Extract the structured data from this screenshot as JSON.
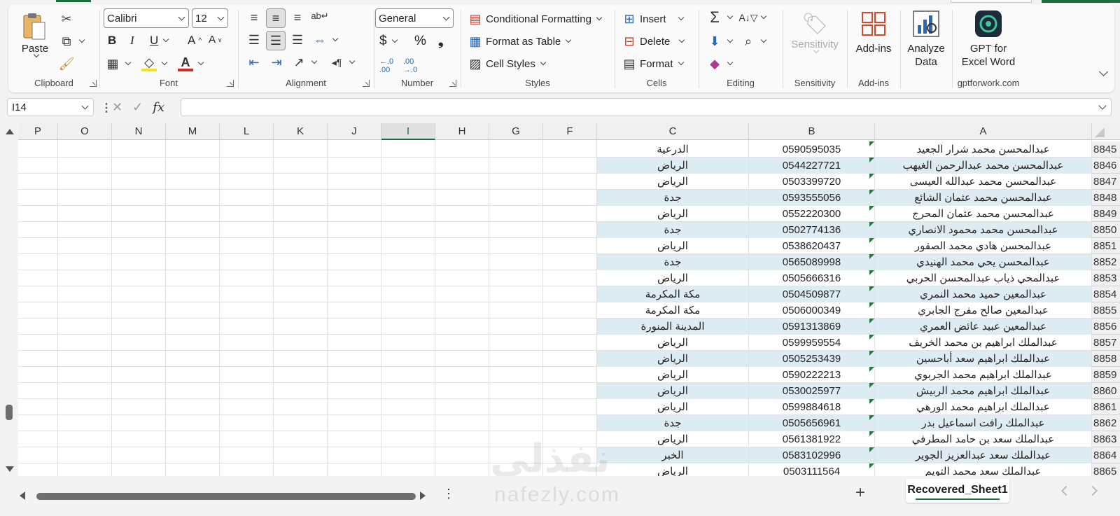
{
  "ribbon": {
    "clipboard": {
      "paste": "Paste",
      "label": "Clipboard"
    },
    "font": {
      "name": "Calibri",
      "size": "12",
      "label": "Font"
    },
    "alignment": {
      "label": "Alignment"
    },
    "number": {
      "format": "General",
      "currency": "$",
      "percent": "%",
      "comma": "❟",
      "label": "Number"
    },
    "styles": {
      "conditional": "Conditional Formatting",
      "table": "Format as Table",
      "cell_styles": "Cell Styles",
      "label": "Styles"
    },
    "cells": {
      "insert": "Insert",
      "delete": "Delete",
      "format": "Format",
      "label": "Cells"
    },
    "editing": {
      "label": "Editing"
    },
    "sensitivity": {
      "button": "Sensitivity",
      "label": "Sensitivity"
    },
    "addins": {
      "button": "Add-ins",
      "label": "Add-ins"
    },
    "analyze": {
      "line1": "Analyze",
      "line2": "Data"
    },
    "gpt": {
      "line1": "GPT for",
      "line2": "Excel Word",
      "label": "gptforwork.com"
    }
  },
  "formula_bar": {
    "name_box": "I14",
    "fx": "fx",
    "value": ""
  },
  "columns": [
    "P",
    "O",
    "N",
    "M",
    "L",
    "K",
    "J",
    "I",
    "H",
    "G",
    "F",
    "C",
    "B",
    "A"
  ],
  "selected_column": "I",
  "rows": [
    {
      "num": "8845",
      "name": "عبدالمحسن محمد شرار الجعيد",
      "phone": "0590595035",
      "city": "الدرعية"
    },
    {
      "num": "8846",
      "name": "عبدالمحسن محمد عبدالرحمن الغيهب",
      "phone": "0544227721",
      "city": "الرياض"
    },
    {
      "num": "8847",
      "name": "عبدالمحسن محمد عبدالله العيسى",
      "phone": "0503399720",
      "city": "الرياض"
    },
    {
      "num": "8848",
      "name": "عبدالمحسن محمد عثمان الشائع",
      "phone": "0593555056",
      "city": "جدة"
    },
    {
      "num": "8849",
      "name": "عبدالمحسن محمد عثمان المحرج",
      "phone": "0552220300",
      "city": "الرياض"
    },
    {
      "num": "8850",
      "name": "عبدالمحسن محمد محمود الانصاري",
      "phone": "0502774136",
      "city": "جدة"
    },
    {
      "num": "8851",
      "name": "عبدالمحسن هادي محمد الصقور",
      "phone": "0538620437",
      "city": "الرياض"
    },
    {
      "num": "8852",
      "name": "عبدالمحسن يحي محمد الهنيدي",
      "phone": "0565089998",
      "city": "جدة"
    },
    {
      "num": "8853",
      "name": "عبدالمحي ذياب عبدالمحسن الحربي",
      "phone": "0505666316",
      "city": "الرياض"
    },
    {
      "num": "8854",
      "name": "عبدالمعين حميد محمد النمري",
      "phone": "0504509877",
      "city": "مكة المكرمة"
    },
    {
      "num": "8855",
      "name": "عبدالمعين صالح مفرج الجابري",
      "phone": "0506000349",
      "city": "مكة المكرمة"
    },
    {
      "num": "8856",
      "name": "عبدالمعين عبيد عائض العمري",
      "phone": "0591313869",
      "city": "المدينة المنورة"
    },
    {
      "num": "8857",
      "name": "عبدالملك ابراهيم بن محمد الخريف",
      "phone": "0599959554",
      "city": "الرياض"
    },
    {
      "num": "8858",
      "name": "عبدالملك ابراهيم سعد أباحسين",
      "phone": "0505253439",
      "city": "الرياض"
    },
    {
      "num": "8859",
      "name": "عبدالملك ابراهيم محمد الجربوي",
      "phone": "0590222213",
      "city": "الرياض"
    },
    {
      "num": "8860",
      "name": "عبدالملك ابراهيم محمد الربيش",
      "phone": "0530025977",
      "city": "الرياض"
    },
    {
      "num": "8861",
      "name": "عبدالملك ابراهيم محمد الورهي",
      "phone": "0599884618",
      "city": "الرياض"
    },
    {
      "num": "8862",
      "name": "عبدالملك رافت اسماعيل بدر",
      "phone": "0505656961",
      "city": "جدة"
    },
    {
      "num": "8863",
      "name": "عبدالملك سعد بن حامد المطرفي",
      "phone": "0561381922",
      "city": "الرياض"
    },
    {
      "num": "8864",
      "name": "عبدالملك سعد عبدالعزيز الجوير",
      "phone": "0583102996",
      "city": "الخبر"
    },
    {
      "num": "8865",
      "name": "عبدالملك سعد محمد التويم",
      "phone": "0503111564",
      "city": "الرياض"
    }
  ],
  "sheet_tab": "Recovered_Sheet1",
  "watermark": {
    "arabic": "نفذلي",
    "latin": "nafezly.com"
  },
  "colors": {
    "accent": "#1d6b3f",
    "band": "#ddebf2",
    "conditional_triangle": "#1f7a3f"
  }
}
